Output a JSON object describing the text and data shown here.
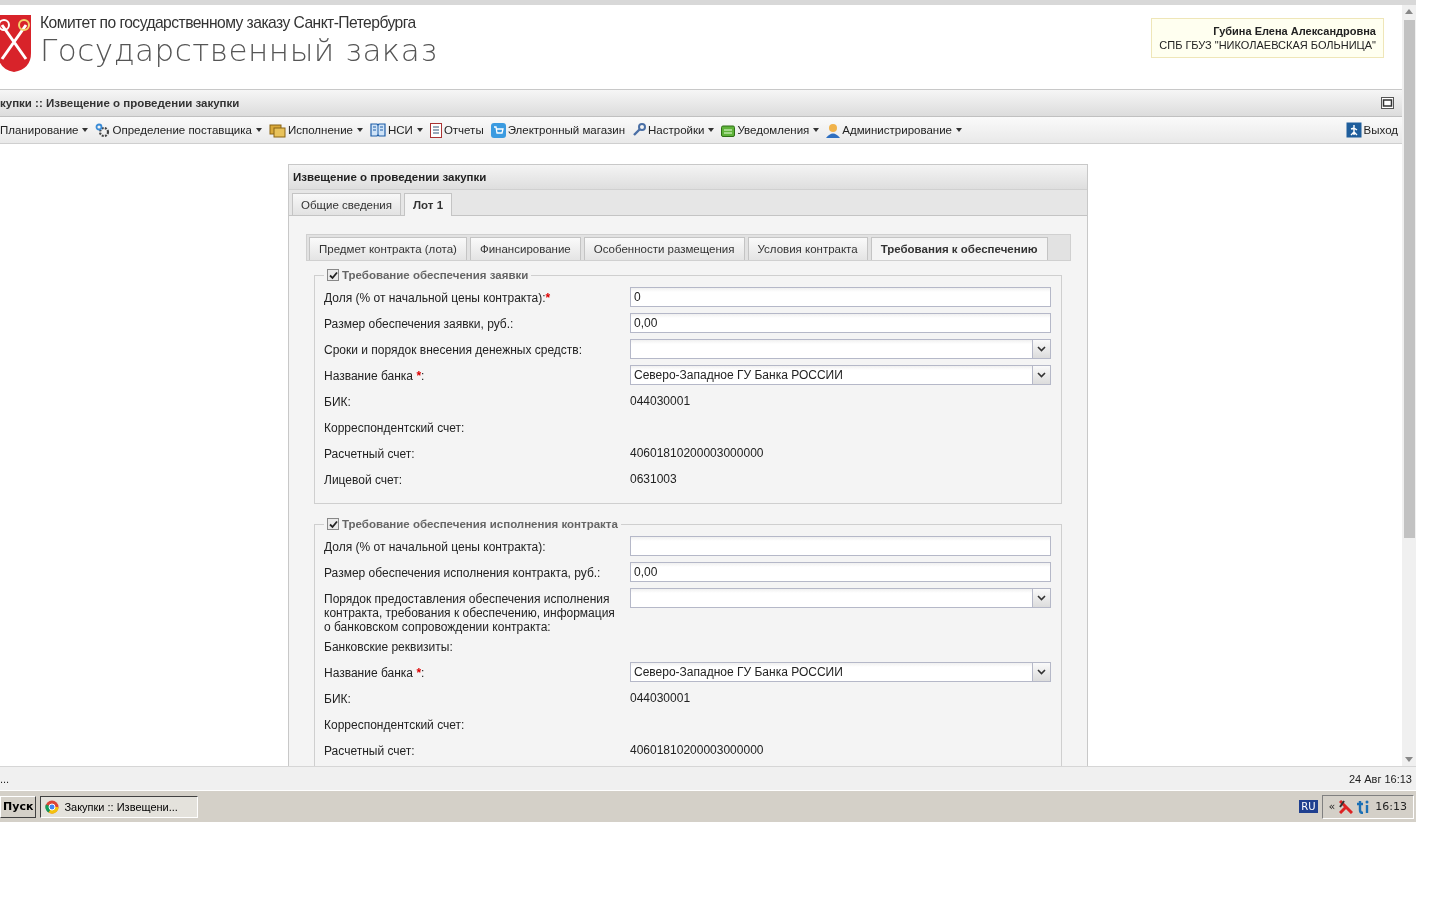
{
  "header": {
    "committee": "Комитет по государственному заказу Санкт-Петербурга",
    "title": "Государственный заказ",
    "user": {
      "name": "Губина Елена Александровна",
      "organization": "СПБ ГБУЗ \"НИКОЛАЕВСКАЯ БОЛЬНИЦА\""
    }
  },
  "page_title": "купки :: Извещение о проведении закупки",
  "menu": [
    {
      "label": "Планирование",
      "dropdown": true
    },
    {
      "label": "Определение поставщика",
      "dropdown": true
    },
    {
      "label": "Исполнение",
      "dropdown": true
    },
    {
      "label": "НСИ",
      "dropdown": true
    },
    {
      "label": "Отчеты",
      "dropdown": false
    },
    {
      "label": "Электронный магазин",
      "dropdown": false
    },
    {
      "label": "Настройки",
      "dropdown": true
    },
    {
      "label": "Уведомления",
      "dropdown": true
    },
    {
      "label": "Администрирование",
      "dropdown": true
    }
  ],
  "logout": "Выход",
  "panel": {
    "title": "Извещение о проведении закупки",
    "tabs": [
      {
        "label": "Общие сведения",
        "selected": false
      },
      {
        "label": "Лот 1",
        "selected": true
      }
    ],
    "subtabs": [
      {
        "label": "Предмет контракта (лота)",
        "selected": false
      },
      {
        "label": "Финансирование",
        "selected": false
      },
      {
        "label": "Особенности размещения",
        "selected": false
      },
      {
        "label": "Условия контракта",
        "selected": false
      },
      {
        "label": "Требования к обеспечению",
        "selected": true
      }
    ],
    "sections": [
      {
        "legend": "Требование обеспечения заявки",
        "checked": true,
        "rows": [
          {
            "kind": "input",
            "label": "Доля (% от начальной цены контракта):",
            "required_mark": "*",
            "value": "0"
          },
          {
            "kind": "input",
            "label": "Размер обеспечения заявки, руб.:",
            "value": "0,00"
          },
          {
            "kind": "select",
            "label": "Сроки и порядок внесения денежных средств:"
          },
          {
            "kind": "select",
            "label": "Название банка ",
            "required_mark": "*",
            "suffix": ":",
            "value": "Северо-Западное ГУ Банка РОССИИ"
          },
          {
            "kind": "text",
            "label": "БИК:",
            "value": "044030001"
          },
          {
            "kind": "text",
            "label": "Корреспондентский счет:"
          },
          {
            "kind": "text",
            "label": "Расчетный счет:",
            "value": "40601810200003000000"
          },
          {
            "kind": "text",
            "label": "Лицевой счет:",
            "value": "0631003"
          }
        ]
      },
      {
        "legend": "Требование обеспечения исполнения контракта",
        "checked": true,
        "rows": [
          {
            "kind": "input",
            "label": "Доля (% от начальной цены контракта):"
          },
          {
            "kind": "input",
            "label": "Размер обеспечения исполнения контракта, руб.:",
            "value": "0,00"
          },
          {
            "kind": "select",
            "label": "Порядок предоставления обеспечения исполнения контракта, требования к обеспечению, информация о банковском сопровождении контракта:"
          },
          {
            "kind": "text",
            "label": "Банковские реквизиты:"
          },
          {
            "kind": "select",
            "label": "Название банка ",
            "required_mark": "*",
            "suffix": ":",
            "value": "Северо-Западное ГУ Банка РОССИИ"
          },
          {
            "kind": "text",
            "label": "БИК:",
            "value": "044030001"
          },
          {
            "kind": "text",
            "label": "Корреспондентский счет:"
          },
          {
            "kind": "text",
            "label": "Расчетный счет:",
            "value": "40601810200003000000"
          }
        ]
      }
    ]
  },
  "status_bar": {
    "left": "...",
    "right": "24 Авг 16:13"
  },
  "taskbar": {
    "start": "Пуск",
    "tasks": [
      {
        "label": "Закупки :: Извещени...",
        "selected": true
      }
    ],
    "language": "RU",
    "tray_expand": "«",
    "clock": "16:13"
  }
}
